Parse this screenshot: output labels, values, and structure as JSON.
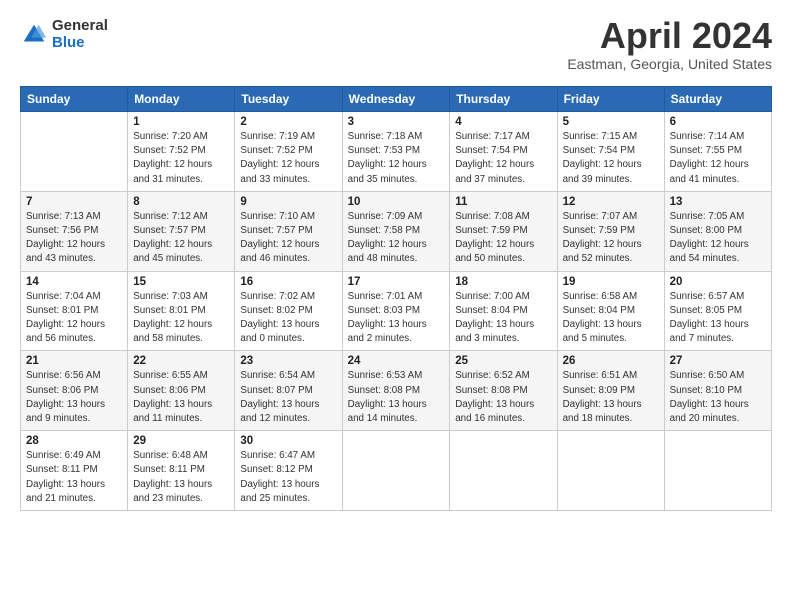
{
  "header": {
    "logo_general": "General",
    "logo_blue": "Blue",
    "title": "April 2024",
    "subtitle": "Eastman, Georgia, United States"
  },
  "calendar": {
    "days_of_week": [
      "Sunday",
      "Monday",
      "Tuesday",
      "Wednesday",
      "Thursday",
      "Friday",
      "Saturday"
    ],
    "weeks": [
      [
        {
          "day": "",
          "info": ""
        },
        {
          "day": "1",
          "info": "Sunrise: 7:20 AM\nSunset: 7:52 PM\nDaylight: 12 hours\nand 31 minutes."
        },
        {
          "day": "2",
          "info": "Sunrise: 7:19 AM\nSunset: 7:52 PM\nDaylight: 12 hours\nand 33 minutes."
        },
        {
          "day": "3",
          "info": "Sunrise: 7:18 AM\nSunset: 7:53 PM\nDaylight: 12 hours\nand 35 minutes."
        },
        {
          "day": "4",
          "info": "Sunrise: 7:17 AM\nSunset: 7:54 PM\nDaylight: 12 hours\nand 37 minutes."
        },
        {
          "day": "5",
          "info": "Sunrise: 7:15 AM\nSunset: 7:54 PM\nDaylight: 12 hours\nand 39 minutes."
        },
        {
          "day": "6",
          "info": "Sunrise: 7:14 AM\nSunset: 7:55 PM\nDaylight: 12 hours\nand 41 minutes."
        }
      ],
      [
        {
          "day": "7",
          "info": "Sunrise: 7:13 AM\nSunset: 7:56 PM\nDaylight: 12 hours\nand 43 minutes."
        },
        {
          "day": "8",
          "info": "Sunrise: 7:12 AM\nSunset: 7:57 PM\nDaylight: 12 hours\nand 45 minutes."
        },
        {
          "day": "9",
          "info": "Sunrise: 7:10 AM\nSunset: 7:57 PM\nDaylight: 12 hours\nand 46 minutes."
        },
        {
          "day": "10",
          "info": "Sunrise: 7:09 AM\nSunset: 7:58 PM\nDaylight: 12 hours\nand 48 minutes."
        },
        {
          "day": "11",
          "info": "Sunrise: 7:08 AM\nSunset: 7:59 PM\nDaylight: 12 hours\nand 50 minutes."
        },
        {
          "day": "12",
          "info": "Sunrise: 7:07 AM\nSunset: 7:59 PM\nDaylight: 12 hours\nand 52 minutes."
        },
        {
          "day": "13",
          "info": "Sunrise: 7:05 AM\nSunset: 8:00 PM\nDaylight: 12 hours\nand 54 minutes."
        }
      ],
      [
        {
          "day": "14",
          "info": "Sunrise: 7:04 AM\nSunset: 8:01 PM\nDaylight: 12 hours\nand 56 minutes."
        },
        {
          "day": "15",
          "info": "Sunrise: 7:03 AM\nSunset: 8:01 PM\nDaylight: 12 hours\nand 58 minutes."
        },
        {
          "day": "16",
          "info": "Sunrise: 7:02 AM\nSunset: 8:02 PM\nDaylight: 13 hours\nand 0 minutes."
        },
        {
          "day": "17",
          "info": "Sunrise: 7:01 AM\nSunset: 8:03 PM\nDaylight: 13 hours\nand 2 minutes."
        },
        {
          "day": "18",
          "info": "Sunrise: 7:00 AM\nSunset: 8:04 PM\nDaylight: 13 hours\nand 3 minutes."
        },
        {
          "day": "19",
          "info": "Sunrise: 6:58 AM\nSunset: 8:04 PM\nDaylight: 13 hours\nand 5 minutes."
        },
        {
          "day": "20",
          "info": "Sunrise: 6:57 AM\nSunset: 8:05 PM\nDaylight: 13 hours\nand 7 minutes."
        }
      ],
      [
        {
          "day": "21",
          "info": "Sunrise: 6:56 AM\nSunset: 8:06 PM\nDaylight: 13 hours\nand 9 minutes."
        },
        {
          "day": "22",
          "info": "Sunrise: 6:55 AM\nSunset: 8:06 PM\nDaylight: 13 hours\nand 11 minutes."
        },
        {
          "day": "23",
          "info": "Sunrise: 6:54 AM\nSunset: 8:07 PM\nDaylight: 13 hours\nand 12 minutes."
        },
        {
          "day": "24",
          "info": "Sunrise: 6:53 AM\nSunset: 8:08 PM\nDaylight: 13 hours\nand 14 minutes."
        },
        {
          "day": "25",
          "info": "Sunrise: 6:52 AM\nSunset: 8:08 PM\nDaylight: 13 hours\nand 16 minutes."
        },
        {
          "day": "26",
          "info": "Sunrise: 6:51 AM\nSunset: 8:09 PM\nDaylight: 13 hours\nand 18 minutes."
        },
        {
          "day": "27",
          "info": "Sunrise: 6:50 AM\nSunset: 8:10 PM\nDaylight: 13 hours\nand 20 minutes."
        }
      ],
      [
        {
          "day": "28",
          "info": "Sunrise: 6:49 AM\nSunset: 8:11 PM\nDaylight: 13 hours\nand 21 minutes."
        },
        {
          "day": "29",
          "info": "Sunrise: 6:48 AM\nSunset: 8:11 PM\nDaylight: 13 hours\nand 23 minutes."
        },
        {
          "day": "30",
          "info": "Sunrise: 6:47 AM\nSunset: 8:12 PM\nDaylight: 13 hours\nand 25 minutes."
        },
        {
          "day": "",
          "info": ""
        },
        {
          "day": "",
          "info": ""
        },
        {
          "day": "",
          "info": ""
        },
        {
          "day": "",
          "info": ""
        }
      ]
    ]
  }
}
